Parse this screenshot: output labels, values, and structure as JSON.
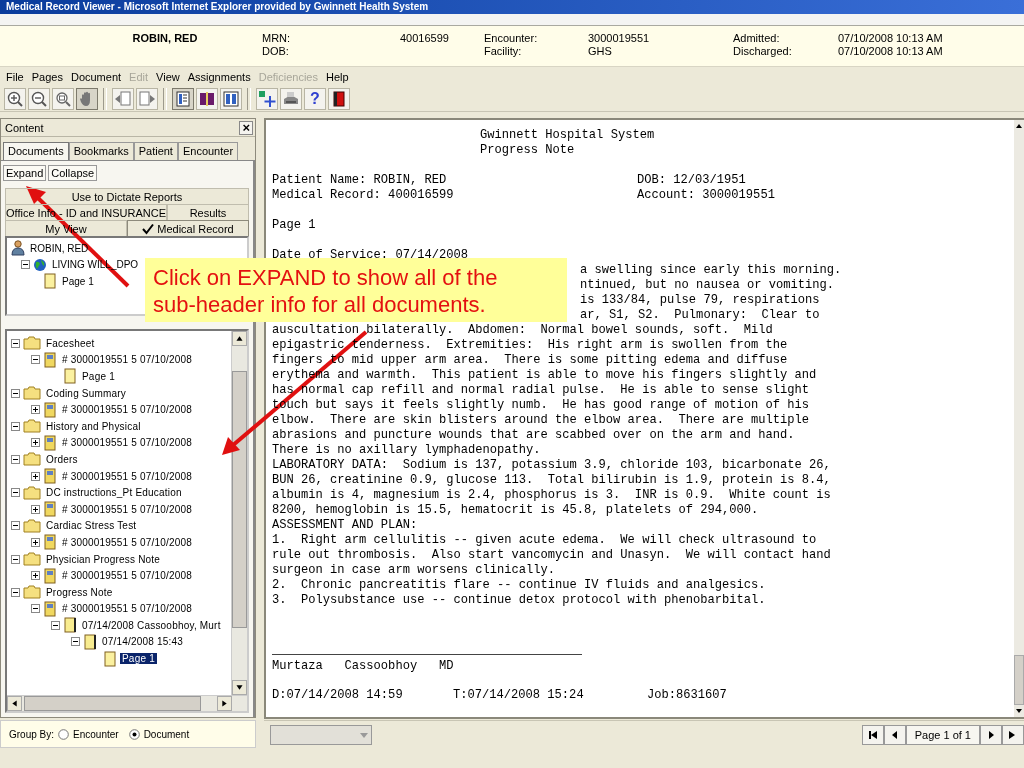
{
  "window": {
    "title": "Medical Record Viewer - Microsoft Internet Explorer provided by Gwinnett Health System"
  },
  "header": {
    "patient": "ROBIN, RED",
    "fields": [
      {
        "label": "MRN:",
        "value": "40016599"
      },
      {
        "label": "DOB:"
      },
      {
        "label": "Encounter:",
        "value": "3000019551"
      },
      {
        "label": "Facility:",
        "value": "GHS"
      },
      {
        "label": "Admitted:",
        "value": "07/10/2008 10:13 AM"
      },
      {
        "label": "Discharged:",
        "value": "07/10/2008 10:13 AM"
      }
    ]
  },
  "menu": [
    {
      "label": "File",
      "disabled": false
    },
    {
      "label": "Pages",
      "disabled": false
    },
    {
      "label": "Document",
      "disabled": false
    },
    {
      "label": "Edit",
      "disabled": true
    },
    {
      "label": "View",
      "disabled": false
    },
    {
      "label": "Assignments",
      "disabled": false
    },
    {
      "label": "Deficiencies",
      "disabled": true
    },
    {
      "label": "Help",
      "disabled": false
    }
  ],
  "toolbar": [
    {
      "kind": "zoom_in",
      "pressed": false
    },
    {
      "kind": "zoom_out",
      "pressed": false
    },
    {
      "kind": "zoom_fit",
      "pressed": false
    },
    {
      "kind": "pan",
      "pressed": true
    },
    {
      "kind": "separator"
    },
    {
      "kind": "prev_doc",
      "pressed": false
    },
    {
      "kind": "next_doc",
      "pressed": false
    },
    {
      "kind": "separator"
    },
    {
      "kind": "view_single",
      "pressed": true
    },
    {
      "kind": "view_book",
      "pressed": false
    },
    {
      "kind": "view_double",
      "pressed": false
    },
    {
      "kind": "separator"
    },
    {
      "kind": "add",
      "pressed": false
    },
    {
      "kind": "print",
      "pressed": false
    },
    {
      "kind": "help",
      "label": "?",
      "pressed": false
    },
    {
      "kind": "exit",
      "pressed": false
    }
  ],
  "panel": {
    "title": "Content",
    "close": "×",
    "tabs": [
      {
        "label": "Documents",
        "selected": true
      },
      {
        "label": "Bookmarks",
        "selected": false
      },
      {
        "label": "Patient",
        "selected": false
      },
      {
        "label": "Encounter",
        "selected": false
      }
    ],
    "buttons": [
      "Expand",
      "Collapse"
    ],
    "views": [
      [
        {
          "label": "Use to Dictate Reports",
          "selected": false
        }
      ],
      [
        {
          "label": "Office Info - ID and INSURANCE",
          "selected": false
        },
        {
          "label": "Results",
          "selected": false
        }
      ],
      [
        {
          "label": "My View",
          "selected": false
        },
        {
          "label": "Medical Record",
          "selected": true
        }
      ]
    ],
    "top_tree": [
      {
        "label": "ROBIN, RED",
        "kind": "patient",
        "selected": false,
        "children": [
          {
            "label": "LIVING WILL_DPO",
            "kind": "form",
            "expanded": true,
            "selected": false,
            "children": [
              {
                "label": "Page 1",
                "kind": "page",
                "selected": false
              }
            ]
          }
        ]
      }
    ],
    "tree": [
      {
        "label": "Facesheet",
        "kind": "category",
        "expanded": true,
        "selected": false,
        "children": [
          {
            "label": "# 3000019551 5 07/10/2008",
            "kind": "encounter",
            "expanded": true,
            "selected": false,
            "children": [
              {
                "label": "Page 1",
                "kind": "page",
                "selected": false
              }
            ]
          }
        ]
      },
      {
        "label": "Coding Summary",
        "kind": "category",
        "expanded": true,
        "selected": false,
        "children": [
          {
            "label": "# 3000019551 5 07/10/2008",
            "kind": "encounter",
            "expanded": false,
            "selected": false
          }
        ]
      },
      {
        "label": "History and Physical",
        "kind": "category",
        "expanded": true,
        "selected": false,
        "children": [
          {
            "label": "# 3000019551 5 07/10/2008",
            "kind": "encounter",
            "expanded": false,
            "selected": false
          }
        ]
      },
      {
        "label": "Orders",
        "kind": "category",
        "expanded": true,
        "selected": false,
        "children": [
          {
            "label": "# 3000019551 5 07/10/2008",
            "kind": "encounter",
            "expanded": false,
            "selected": false
          }
        ]
      },
      {
        "label": "DC instructions_Pt Education",
        "kind": "category",
        "expanded": true,
        "selected": false,
        "children": [
          {
            "label": "# 3000019551 5 07/10/2008",
            "kind": "encounter",
            "expanded": false,
            "selected": false
          }
        ]
      },
      {
        "label": "Cardiac Stress Test",
        "kind": "category",
        "expanded": true,
        "selected": false,
        "children": [
          {
            "label": "# 3000019551 5 07/10/2008",
            "kind": "encounter",
            "expanded": false,
            "selected": false
          }
        ]
      },
      {
        "label": "Physician Progress Note",
        "kind": "category",
        "expanded": true,
        "selected": false,
        "children": [
          {
            "label": "# 3000019551 5 07/10/2008",
            "kind": "encounter",
            "expanded": false,
            "selected": false
          }
        ]
      },
      {
        "label": "Progress Note",
        "kind": "category",
        "expanded": true,
        "selected": false,
        "children": [
          {
            "label": "# 3000019551 5 07/10/2008",
            "kind": "encounter",
            "expanded": true,
            "selected": false,
            "children": [
              {
                "label": "07/14/2008 Cassoobhoy, Murt",
                "kind": "note",
                "expanded": true,
                "selected": false,
                "children": [
                  {
                    "label": "07/14/2008 15:43",
                    "kind": "note",
                    "expanded": true,
                    "selected": false,
                    "children": [
                      {
                        "label": "Page 1",
                        "kind": "page",
                        "selected": true
                      }
                    ]
                  }
                ]
              }
            ]
          }
        ]
      }
    ],
    "group_by": {
      "label": "Group By:",
      "options": [
        {
          "label": "Encounter",
          "selected": false
        },
        {
          "label": "Document",
          "selected": true
        }
      ]
    }
  },
  "document": {
    "heading": [
      "Gwinnett Hospital System",
      "Progress Note"
    ],
    "fields": [
      [
        "Patient Name: ROBIN, RED",
        "DOB: 12/03/1951"
      ],
      [
        "Medical Record: 400016599",
        "Account: 3000019551"
      ]
    ],
    "page_label": "Page 1",
    "date_line": "Date of Service: 07/14/2008",
    "lines": [
      {
        "kind": "tail",
        "text": "a swelling since early this morning."
      },
      {
        "kind": "tail",
        "text": "ntinued, but no nausea or vomiting."
      },
      {
        "kind": "tail",
        "text": "is 133/84, pulse 79, respirations"
      },
      {
        "kind": "tail",
        "text": "ar, S1, S2.  Pulmonary:  Clear to"
      },
      {
        "kind": "full",
        "text": "auscultation bilaterally.  Abdomen:  Normal bowel sounds, soft.  Mild"
      },
      {
        "kind": "full",
        "text": "epigastric tenderness.  Extremities:  His right arm is swollen from the"
      },
      {
        "kind": "full",
        "text": "fingers to mid upper arm area.  There is some pitting edema and diffuse"
      },
      {
        "kind": "full",
        "text": "erythema and warmth.  This patient is able to move his fingers slightly and"
      },
      {
        "kind": "full",
        "text": "has normal cap refill and normal radial pulse.  He is able to sense slight"
      },
      {
        "kind": "full",
        "text": "touch but says it feels slightly numb.  He has good range of motion of his"
      },
      {
        "kind": "full",
        "text": "elbow.  There are skin blisters around the elbow area.  There are multiple"
      },
      {
        "kind": "full",
        "text": "abrasions and puncture wounds that are scabbed over on the arm and hand."
      },
      {
        "kind": "full",
        "text": "There is no axillary lymphadenopathy."
      },
      {
        "kind": "full",
        "text": "LABORATORY DATA:  Sodium is 137, potassium 3.9, chloride 103, bicarbonate 26,"
      },
      {
        "kind": "full",
        "text": "BUN 26, creatinine 0.9, glucose 113.  Total bilirubin is 1.9, protein is 8.4,"
      },
      {
        "kind": "full",
        "text": "albumin is 4, magnesium is 2.4, phosphorus is 3.  INR is 0.9.  White count is"
      },
      {
        "kind": "full",
        "text": "8200, hemoglobin is 15.5, hematocrit is 45.8, platelets of 294,000."
      },
      {
        "kind": "full",
        "text": "ASSESSMENT AND PLAN:"
      },
      {
        "kind": "full",
        "text": "1.  Right arm cellulitis -- given acute edema.  We will check ultrasound to"
      },
      {
        "kind": "full",
        "text": "rule out thrombosis.  Also start vancomycin and Unasyn.  We will contact hand"
      },
      {
        "kind": "full",
        "text": "surgeon in case arm worsens clinically."
      },
      {
        "kind": "full",
        "text": "2.  Chronic pancreatitis flare -- continue IV fluids and analgesics."
      },
      {
        "kind": "full",
        "text": "3.  Polysubstance use -- continue detox protocol with phenobarbital."
      }
    ],
    "signature": "Murtaza   Cassoobhoy   MD",
    "footer": [
      "D:07/14/2008 14:59",
      "T:07/14/2008 15:24",
      "Job:8631607"
    ]
  },
  "pager": {
    "label": "Page 1 of 1"
  },
  "callout": {
    "lines": [
      "Click on EXPAND to show all of the",
      "sub-header info for all documents."
    ]
  }
}
